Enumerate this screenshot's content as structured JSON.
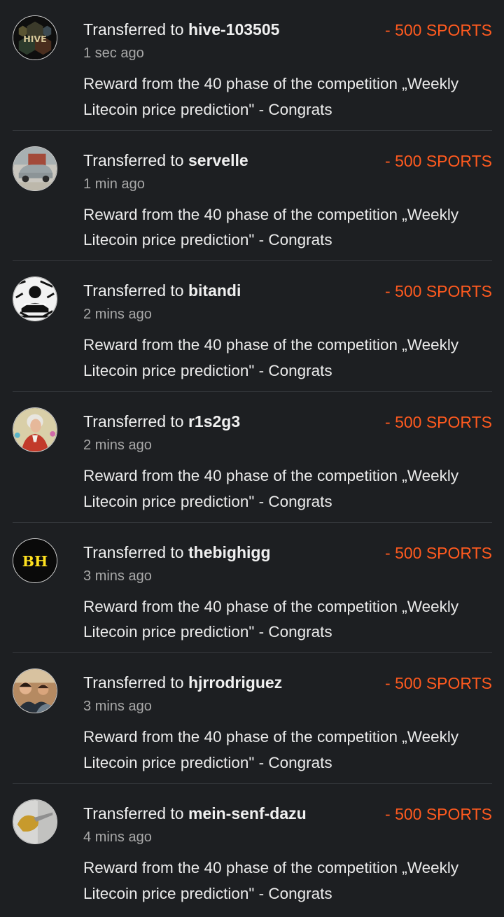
{
  "transfers": [
    {
      "prefix": "Transferred to",
      "user": "hive-103505",
      "amount": "- 500 SPORTS",
      "time": "1 sec ago",
      "memo": "Reward from the 40 phase of the competition „Weekly Litecoin price prediction\" - Congrats",
      "avatar": "hive-logo-avatar"
    },
    {
      "prefix": "Transferred to",
      "user": "servelle",
      "amount": "- 500 SPORTS",
      "time": "1 min ago",
      "memo": "Reward from the 40 phase of the competition „Weekly Litecoin price prediction\" - Congrats",
      "avatar": "car-photo-avatar"
    },
    {
      "prefix": "Transferred to",
      "user": "bitandi",
      "amount": "- 500 SPORTS",
      "time": "2 mins ago",
      "memo": "Reward from the 40 phase of the competition „Weekly Litecoin price prediction\" - Congrats",
      "avatar": "sketch-avatar"
    },
    {
      "prefix": "Transferred to",
      "user": "r1s2g3",
      "amount": "- 500 SPORTS",
      "time": "2 mins ago",
      "memo": "Reward from the 40 phase of the competition „Weekly Litecoin price prediction\" - Congrats",
      "avatar": "portrait-avatar"
    },
    {
      "prefix": "Transferred to",
      "user": "thebighigg",
      "amount": "- 500 SPORTS",
      "time": "3 mins ago",
      "memo": "Reward from the 40 phase of the competition „Weekly Litecoin price prediction\" - Congrats",
      "avatar": "bh-logo-avatar",
      "avatar_text": "BH"
    },
    {
      "prefix": "Transferred to",
      "user": "hjrrodriguez",
      "amount": "- 500 SPORTS",
      "time": "3 mins ago",
      "memo": "Reward from the 40 phase of the competition „Weekly Litecoin price prediction\" - Congrats",
      "avatar": "group-photo-avatar"
    },
    {
      "prefix": "Transferred to",
      "user": "mein-senf-dazu",
      "amount": "- 500 SPORTS",
      "time": "4 mins ago",
      "memo": "Reward from the 40 phase of the competition „Weekly Litecoin price prediction\" - Congrats",
      "avatar": "mustard-photo-avatar"
    }
  ],
  "colors": {
    "background": "#1d1f22",
    "amount": "#ff5a1f",
    "divider": "#34373b",
    "muted": "#a8a8a8"
  }
}
